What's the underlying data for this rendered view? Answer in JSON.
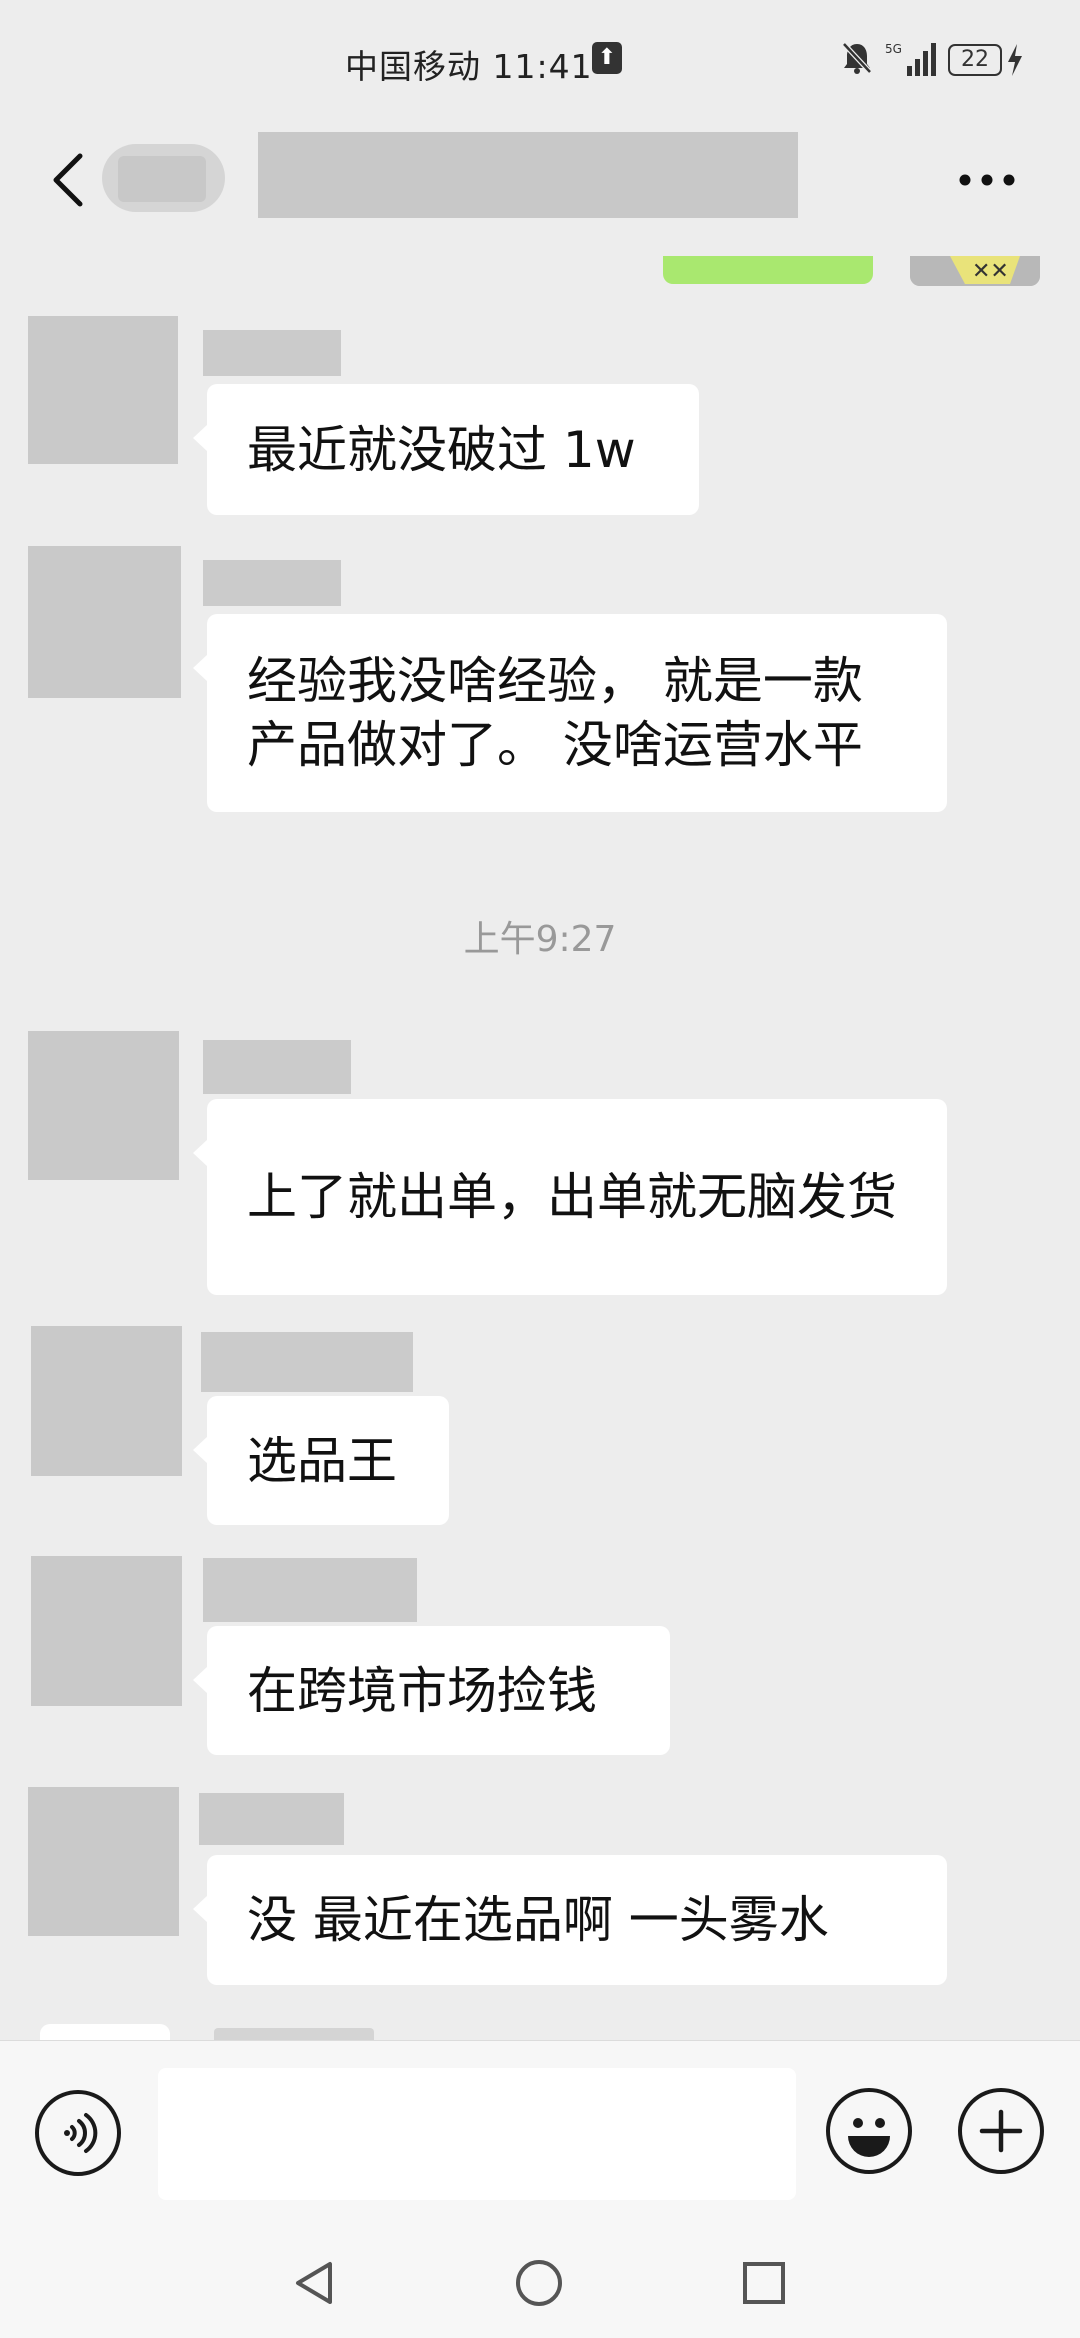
{
  "status_bar": {
    "carrier": "中国移动",
    "time": "11:41",
    "network": "5G",
    "battery": "22"
  },
  "header": {
    "back": "back-icon",
    "more": "more-icon"
  },
  "messages": [
    {
      "text": "最近就没破过 1w"
    },
    {
      "text": "经验我没啥经验，  就是一款产品做对了。  没啥运营水平"
    },
    {
      "text": "上了就出单，出单就无脑发货"
    },
    {
      "text": "选品王"
    },
    {
      "text": "在跨境市场捡钱"
    },
    {
      "text": "没  最近在选品啊   一头雾水"
    }
  ],
  "timestamp": "上午9:27",
  "input_bar": {
    "voice": "voice-icon",
    "input_value": "",
    "emoji": "emoji-icon",
    "plus": "plus-icon"
  },
  "system_nav": [
    "back-triangle-icon",
    "home-circle-icon",
    "recents-square-icon"
  ],
  "colors": {
    "background": "#ededed",
    "bubble": "#ffffff",
    "self_bubble": "#a9e86f",
    "placeholder": "#c9c9c9"
  }
}
